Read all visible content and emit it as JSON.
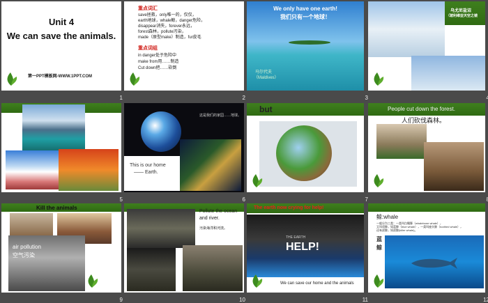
{
  "slides": [
    {
      "n": "1",
      "title1": "Unit 4",
      "title2": "We can save the animals.",
      "footer": "第一PPT模板网-WWW.1PPT.COM"
    },
    {
      "n": "2",
      "vocab_head": "重点词汇",
      "vocab": [
        "save拯救，only唯一的，仅仅，",
        "earth地球，whale鲸，danger危险，",
        "disappear消失，forever永远，",
        "forest森林，pollute污染，",
        "made（原型make）制造，fur皮毛"
      ],
      "phrase_head": "重点词组",
      "phrases": [
        "in danger处于危险中",
        "make from用……制造",
        "Cut down把……砍倒"
      ]
    },
    {
      "n": "3",
      "title1": "We  only have one earth!",
      "title2": "我们只有一个地球！",
      "caption1": "马尔代夫",
      "caption2": "（Maldives）"
    },
    {
      "n": "4",
      "caption1": "乌尤尼盐沼",
      "caption2": "（玻利维亚天空之镜"
    },
    {
      "n": "5"
    },
    {
      "n": "6",
      "note": "这是我们的家园……地球。",
      "text1": "This is our home",
      "text2": "—— Earth."
    },
    {
      "n": "7",
      "word": "but"
    },
    {
      "n": "8",
      "title1": "People cut down the forest.",
      "title2": "人们砍伐森林。"
    },
    {
      "n": "9",
      "title": "Kill the animals",
      "caption1": "air pollution",
      "caption2": "空气污染"
    },
    {
      "n": "10",
      "text1": "Pollute the ocean",
      "text2": "and river.",
      "text3": "污染海洋和河流。"
    },
    {
      "n": "11",
      "title": "The earth now crying for help!",
      "help_small": "THE EARTH",
      "help_big": "HELP!",
      "bottom": "We can save our home and the animals"
    },
    {
      "n": "12",
      "title": "鲸:whale",
      "line1": "一般分为三类：一类叫白鳍豚（whalebone whale），",
      "line2": "又叫须鲸，如蓝鲸（blue whale），一类叫座头鲸（toothed whale），",
      "line3": "还有虎鲸，如虎鲸(killer whale)。",
      "side1": "蓝",
      "side2": "鲸"
    }
  ]
}
